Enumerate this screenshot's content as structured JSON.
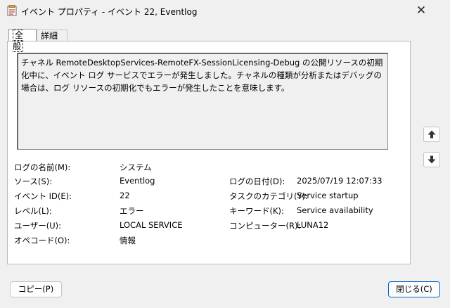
{
  "window": {
    "title": "イベント プロパティ - イベント 22, Eventlog",
    "close_glyph": "✕"
  },
  "tabs": [
    {
      "label": "全般",
      "selected": true
    },
    {
      "label": "詳細",
      "selected": false
    }
  ],
  "description": "チャネル RemoteDesktopServices-RemoteFX-SessionLicensing-Debug の公開リソースの初期化中に、イベント ログ サービスでエラーが発生しました。チャネルの種類が分析またはデバッグの場合は、ログ リソースの初期化でもエラーが発生したことを意味します。",
  "fields": {
    "log_name": {
      "label": "ログの名前(M):",
      "value": "システム"
    },
    "source": {
      "label": "ソース(S):",
      "value": "Eventlog"
    },
    "logged": {
      "label": "ログの日付(D):",
      "value": "2025/07/19 12:07:33"
    },
    "event_id": {
      "label": "イベント ID(E):",
      "value": "22"
    },
    "task_category": {
      "label": "タスクのカテゴリ(Y):",
      "value": "Service startup"
    },
    "level": {
      "label": "レベル(L):",
      "value": "エラー"
    },
    "keywords": {
      "label": "キーワード(K):",
      "value": "Service availability"
    },
    "user": {
      "label": "ユーザー(U):",
      "value": "LOCAL SERVICE"
    },
    "computer": {
      "label": "コンピューター(R):",
      "value": "LUNA12"
    },
    "opcode": {
      "label": "オペコード(O):",
      "value": "情報"
    }
  },
  "buttons": {
    "copy": "コピー(P)",
    "close": "閉じる(C)"
  },
  "icons": {
    "app": "event-properties-icon",
    "up": "arrow-up-icon",
    "down": "arrow-down-icon"
  }
}
